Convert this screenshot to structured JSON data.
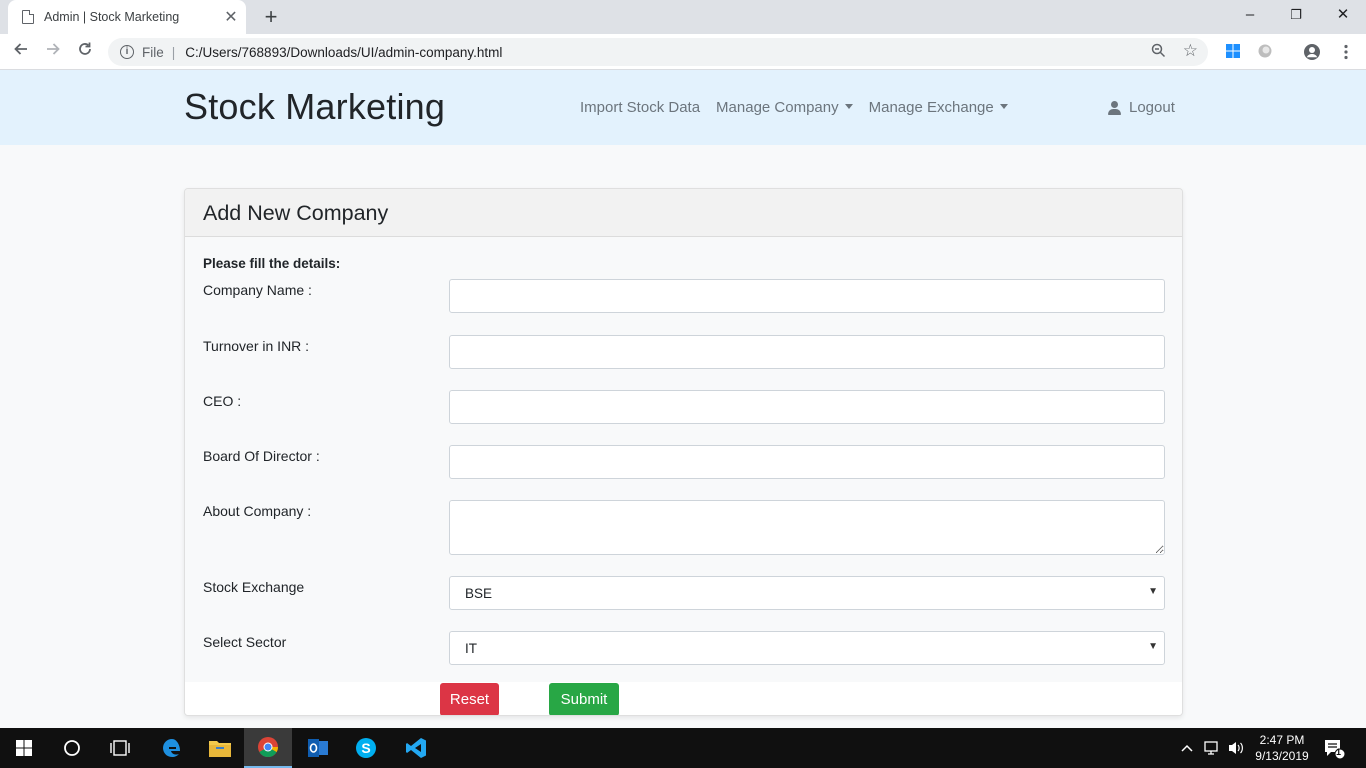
{
  "browser": {
    "tab_title": "Admin | Stock Marketing",
    "tab_close": "✕",
    "new_tab": "+",
    "url_scheme": "File",
    "url": "C:/Users/768893/Downloads/UI/admin-company.html",
    "window_controls": {
      "minimize": "–",
      "restore": "❐",
      "close": "✕"
    }
  },
  "navbar": {
    "brand": "Stock Marketing",
    "links": [
      "Import Stock Data",
      "Manage Company",
      "Manage Exchange"
    ],
    "logout": "Logout"
  },
  "form": {
    "header": "Add New Company",
    "intro": "Please fill the details:",
    "labels": {
      "company_name": "Company Name :",
      "turnover": "Turnover in INR :",
      "ceo": "CEO :",
      "board": "Board Of Director :",
      "about": "About Company :",
      "exchange": "Stock Exchange",
      "sector": "Select Sector"
    },
    "values": {
      "company_name": "",
      "turnover": "",
      "ceo": "",
      "board": "",
      "about": "",
      "exchange": "BSE",
      "sector": "IT"
    },
    "buttons": {
      "reset": "Reset",
      "submit": "Submit"
    }
  },
  "taskbar": {
    "time": "2:47 PM",
    "date": "9/13/2019",
    "notification_count": "1"
  },
  "colors": {
    "navbar_bg": "#e3f2fd",
    "reset_button": "#dc3545",
    "submit_button": "#28a745",
    "taskbar_bg": "#101010"
  }
}
